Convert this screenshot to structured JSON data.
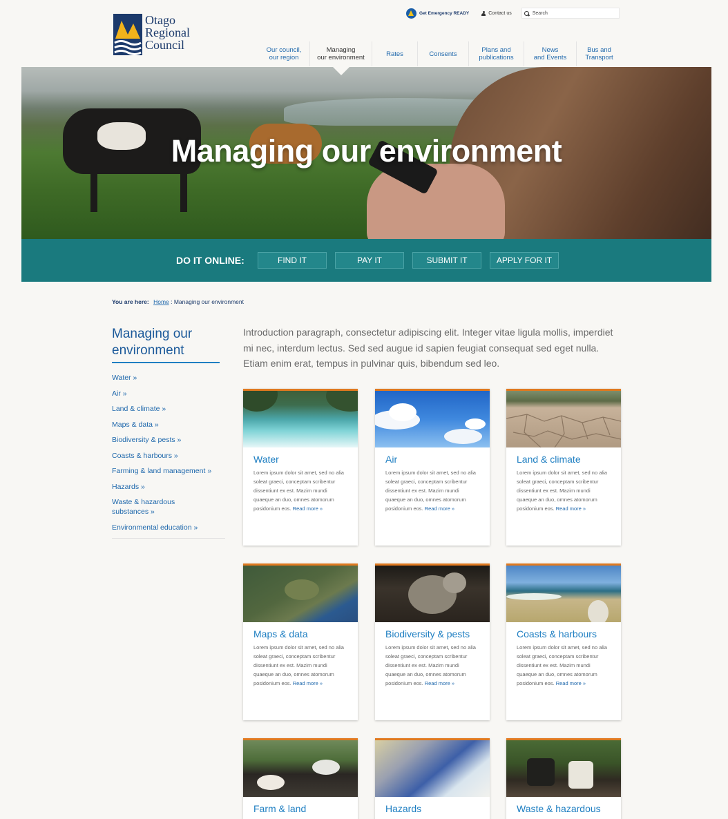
{
  "header": {
    "logo_lines": [
      "Otago",
      "Regional",
      "Council"
    ],
    "emergency_label": "Get Emergency READY",
    "contact_label": "Contact us",
    "search_placeholder": "Search",
    "nav": [
      {
        "line1": "Our council,",
        "line2": "our region"
      },
      {
        "line1": "Managing",
        "line2": "our environment"
      },
      {
        "line1": "Rates",
        "line2": ""
      },
      {
        "line1": "Consents",
        "line2": ""
      },
      {
        "line1": "Plans and",
        "line2": "publications"
      },
      {
        "line1": "News",
        "line2": "and Events"
      },
      {
        "line1": "Bus and",
        "line2": "Transport"
      }
    ]
  },
  "hero": {
    "title": "Managing our environment"
  },
  "online": {
    "label": "DO IT ONLINE:",
    "buttons": [
      "FIND IT",
      "PAY IT",
      "SUBMIT IT",
      "APPLY FOR IT"
    ]
  },
  "breadcrumb": {
    "prefix": "You are here:",
    "home": "Home",
    "current": " : Managing our environment"
  },
  "sidebar": {
    "title": "Managing our environment",
    "items": [
      "Water »",
      "Air »",
      "Land & climate »",
      "Maps & data »",
      "Biodiversity & pests »",
      "Coasts & harbours »",
      "Farming & land management »",
      "Hazards »",
      "Waste & hazardous substances »",
      "Environmental education »"
    ]
  },
  "intro": "Introduction paragraph, consectetur adipiscing elit. Integer vitae ligula mollis, imperdiet mi nec, interdum lectus. Sed sed augue id sapien feugiat consequat sed eget nulla. Etiam enim erat, tempus in pulvinar quis, bibendum sed leo.",
  "cards": [
    {
      "title": "Water",
      "body": "Lorem ipsum dolor sit amet, sed no alia soleat graeci, conceptam scribentur dissentiunt ex est. Mazim mundi quaeque an duo, omnes atomorum posidonium eos.",
      "more": "Read more »"
    },
    {
      "title": "Air",
      "body": "Lorem ipsum dolor sit amet, sed no alia soleat graeci, conceptam scribentur dissentiunt ex est. Mazim mundi quaeque an duo, omnes atomorum posidonium eos.",
      "more": "Read more »"
    },
    {
      "title": "Land & climate",
      "body": "Lorem ipsum dolor sit amet, sed no alia soleat graeci, conceptam scribentur dissentiunt ex est. Mazim mundi quaeque an duo, omnes atomorum posidonium eos.",
      "more": "Read more »"
    },
    {
      "title": "Maps & data",
      "body": "Lorem ipsum dolor sit amet, sed no alia soleat graeci, conceptam scribentur dissentiunt ex est. Mazim mundi quaeque an duo, omnes atomorum posidonium eos.",
      "more": "Read more »"
    },
    {
      "title": "Biodiversity & pests",
      "body": "Lorem ipsum dolor sit amet, sed no alia soleat graeci, conceptam scribentur dissentiunt ex est. Mazim mundi quaeque an duo, omnes atomorum posidonium eos.",
      "more": "Read more »"
    },
    {
      "title": "Coasts & harbours",
      "body": "Lorem ipsum dolor sit amet, sed no alia soleat graeci, conceptam scribentur dissentiunt ex est. Mazim mundi quaeque an duo, omnes atomorum posidonium eos.",
      "more": "Read more »"
    },
    {
      "title": "Farm & land",
      "body": "",
      "more": ""
    },
    {
      "title": "Hazards",
      "body": "",
      "more": ""
    },
    {
      "title": "Waste & hazardous",
      "body": "",
      "more": ""
    }
  ],
  "colors": {
    "brand_navy": "#1c3a6b",
    "link_blue": "#1f68ac",
    "teal_bar": "#1a7a7e",
    "card_accent": "#e0791f",
    "logo_yellow": "#f2b31b"
  }
}
